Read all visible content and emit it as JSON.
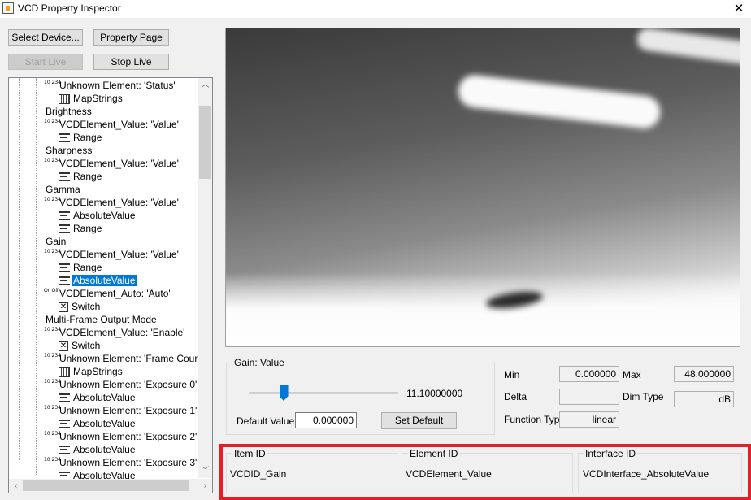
{
  "window": {
    "title": "VCD Property Inspector",
    "close_glyph": "✕",
    "icon": "app-icon"
  },
  "buttons": {
    "select_device": "Select Device...",
    "property_page": "Property Page",
    "start_live": "Start Live",
    "stop_live": "Stop Live",
    "set_default": "Set Default"
  },
  "tree": {
    "items": [
      {
        "icon": "value",
        "label": "Unknown Element: 'Status'"
      },
      {
        "icon": "map",
        "label": "MapStrings"
      },
      {
        "icon": "none",
        "label": "Brightness"
      },
      {
        "icon": "value",
        "label": "VCDElement_Value: 'Value'"
      },
      {
        "icon": "range",
        "label": "Range"
      },
      {
        "icon": "none",
        "label": "Sharpness"
      },
      {
        "icon": "value",
        "label": "VCDElement_Value: 'Value'"
      },
      {
        "icon": "range",
        "label": "Range"
      },
      {
        "icon": "none",
        "label": "Gamma"
      },
      {
        "icon": "value",
        "label": "VCDElement_Value: 'Value'"
      },
      {
        "icon": "range",
        "label": "AbsoluteValue"
      },
      {
        "icon": "range",
        "label": "Range"
      },
      {
        "icon": "none",
        "label": "Gain"
      },
      {
        "icon": "value",
        "label": "VCDElement_Value: 'Value'"
      },
      {
        "icon": "range",
        "label": "Range"
      },
      {
        "icon": "range",
        "label": "AbsoluteValue",
        "selected": true
      },
      {
        "icon": "onoff",
        "label": "VCDElement_Auto: 'Auto'"
      },
      {
        "icon": "switch",
        "label": "Switch"
      },
      {
        "icon": "none",
        "label": "Multi-Frame Output Mode"
      },
      {
        "icon": "value",
        "label": "VCDElement_Value: 'Enable'"
      },
      {
        "icon": "switch",
        "label": "Switch"
      },
      {
        "icon": "value",
        "label": "Unknown Element: 'Frame Count'"
      },
      {
        "icon": "map",
        "label": "MapStrings"
      },
      {
        "icon": "value",
        "label": "Unknown Element: 'Exposure 0'"
      },
      {
        "icon": "range",
        "label": "AbsoluteValue"
      },
      {
        "icon": "value",
        "label": "Unknown Element: 'Exposure 1'"
      },
      {
        "icon": "range",
        "label": "AbsoluteValue"
      },
      {
        "icon": "value",
        "label": "Unknown Element: 'Exposure 2'"
      },
      {
        "icon": "range",
        "label": "AbsoluteValue"
      },
      {
        "icon": "value",
        "label": "Unknown Element: 'Exposure 3'"
      },
      {
        "icon": "range",
        "label": "AbsoluteValue"
      }
    ],
    "icon_value_text": "10 234",
    "icon_onoff_text": "On Off",
    "icon_switch_glyph": "✕"
  },
  "gain_panel": {
    "title": "Gain: Value",
    "slider_value": "11.10000000",
    "slider_fraction": 0.2313,
    "default_label": "Default Value",
    "default_value": "0.000000"
  },
  "properties": {
    "min_label": "Min",
    "min_value": "0.000000",
    "max_label": "Max",
    "max_value": "48.000000",
    "delta_label": "Delta",
    "delta_value": "",
    "dim_type_label": "Dim Type",
    "dim_type_value": "dB",
    "function_type_label": "Function Type",
    "function_type_value": "linear"
  },
  "ids": {
    "item_id_label": "Item ID",
    "item_id_value": "VCDID_Gain",
    "element_id_label": "Element ID",
    "element_id_value": "VCDElement_Value",
    "interface_id_label": "Interface ID",
    "interface_id_value": "VCDInterface_AbsoluteValue"
  },
  "colors": {
    "highlight": "#e2202a",
    "selection": "#0078d7"
  }
}
